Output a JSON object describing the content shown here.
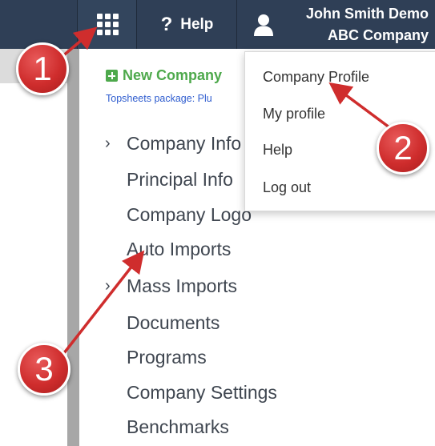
{
  "header": {
    "help_label": "Help",
    "user_name": "John Smith Demo",
    "company_name": "ABC Company"
  },
  "sidebar": {
    "new_company_label": "New Company",
    "topsheets_text": "Topsheets package: Plu",
    "items": [
      {
        "label": "Company Info",
        "expandable": true
      },
      {
        "label": "Principal Info",
        "expandable": false
      },
      {
        "label": "Company Logo",
        "expandable": false
      },
      {
        "label": "Auto Imports",
        "expandable": false
      },
      {
        "label": "Mass Imports",
        "expandable": true
      },
      {
        "label": "Documents",
        "expandable": false
      },
      {
        "label": "Programs",
        "expandable": false
      },
      {
        "label": "Company Settings",
        "expandable": false
      },
      {
        "label": "Benchmarks",
        "expandable": false
      }
    ]
  },
  "user_menu": {
    "items": [
      {
        "label": "Company Profile"
      },
      {
        "label": "My profile"
      },
      {
        "label": "Help"
      },
      {
        "label": "Log out"
      }
    ]
  },
  "callouts": [
    "1",
    "2",
    "3"
  ],
  "colors": {
    "topbar": "#2f3f56",
    "accent_green": "#4ea94c",
    "link_blue": "#2f5dcf",
    "callout_red": "#cf2d2d"
  },
  "icons": [
    "apps-grid-icon",
    "question-icon",
    "user-icon",
    "plus-icon",
    "chevron-right-icon"
  ]
}
